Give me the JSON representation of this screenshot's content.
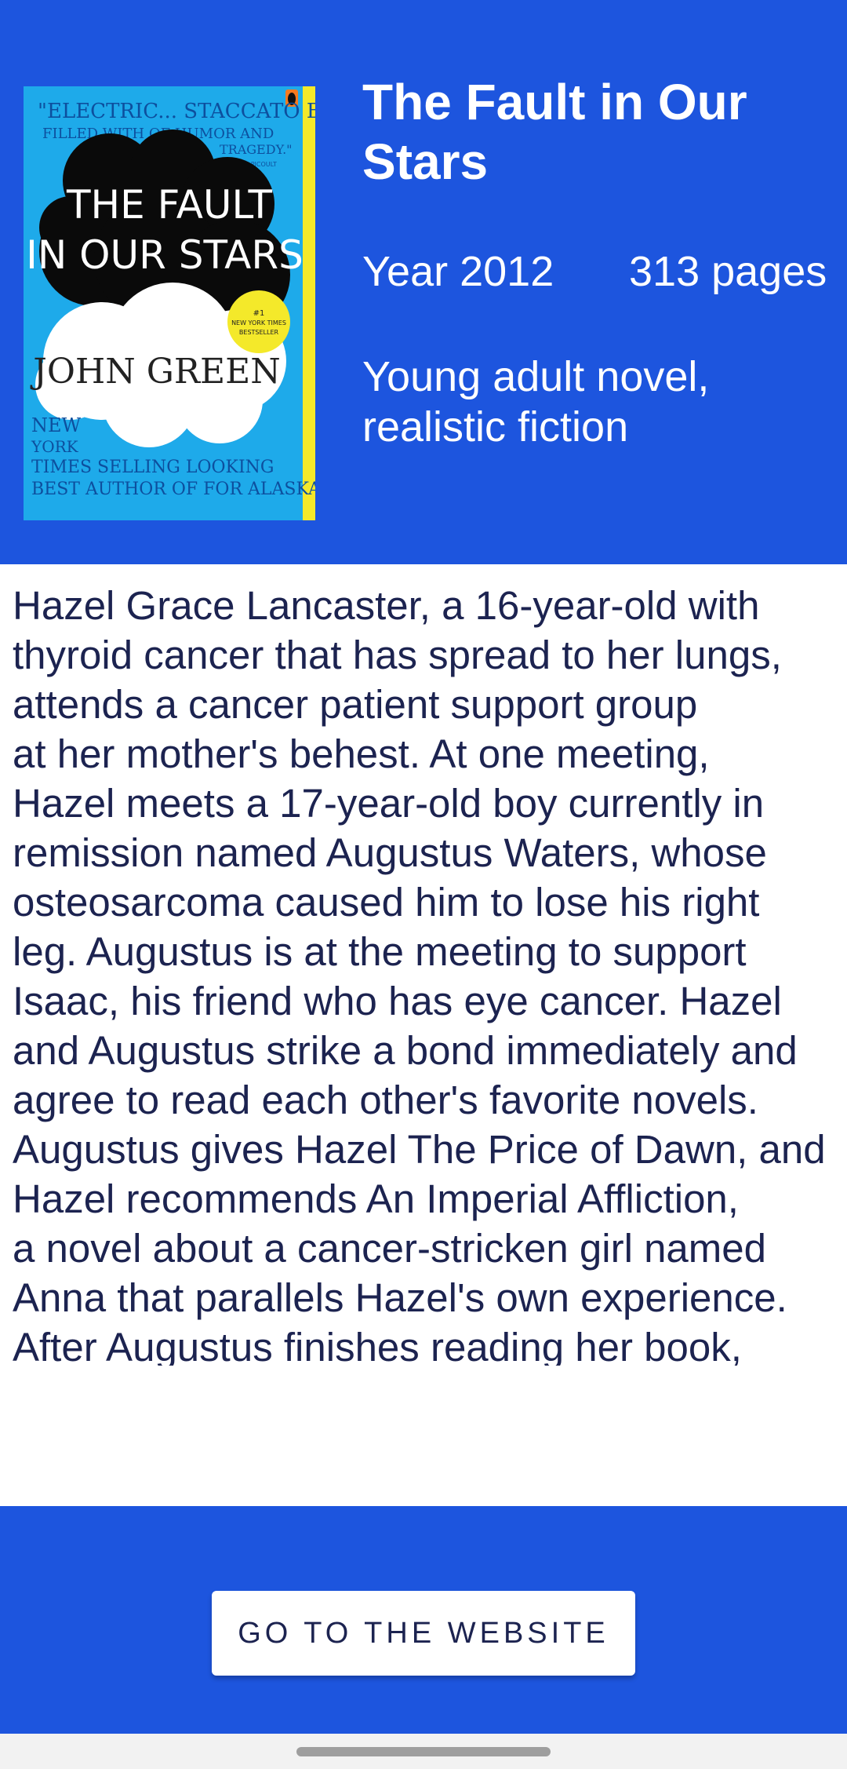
{
  "book": {
    "title": "The Fault in Our Stars",
    "year": "Year 2012",
    "pages": "313 pages",
    "genre": "Young adult novel, realistic fiction",
    "description": "   Hazel Grace Lancaster, a 16-year-old with\nthyroid cancer that has spread to her lungs,\nattends a cancer patient support group\nat her mother's behest. At one meeting,\nHazel meets a 17-year-old boy currently in\nremission named Augustus Waters, whose\nosteosarcoma caused him to lose his right\nleg. Augustus is at the meeting to support\nIsaac, his friend who has eye cancer. Hazel\nand Augustus strike a bond immediately and\nagree to read each other's favorite novels.\nAugustus gives Hazel The Price of Dawn, and\nHazel recommends An Imperial Affliction,\na novel about a cancer-stricken girl named\nAnna that parallels Hazel's own experience.\nAfter Augustus finishes reading her book,"
  },
  "cover": {
    "quote": "\"ELECTRIC... FILLED WITH STACCATO BURSTS OF HUMOR AND TRAGEDY.\"",
    "quote_author": "—JODI PICOULT",
    "title_line1": "THE FAULT",
    "title_line2": "IN OUR STARS",
    "author": "JOHN GREEN",
    "badge_line1": "#1",
    "badge_line2": "NEW YORK TIMES",
    "badge_line3": "BESTSELLER",
    "tagline": "NEW YORK TIMES BESTSELLING AUTHOR OF LOOKING FOR ALASKA"
  },
  "actions": {
    "website_label": "GO TO THE WEBSITE"
  },
  "colors": {
    "primary": "#1d55de",
    "text_dark": "#1c2350",
    "cover_blue": "#1eaaea",
    "cover_yellow": "#f4e92a"
  }
}
